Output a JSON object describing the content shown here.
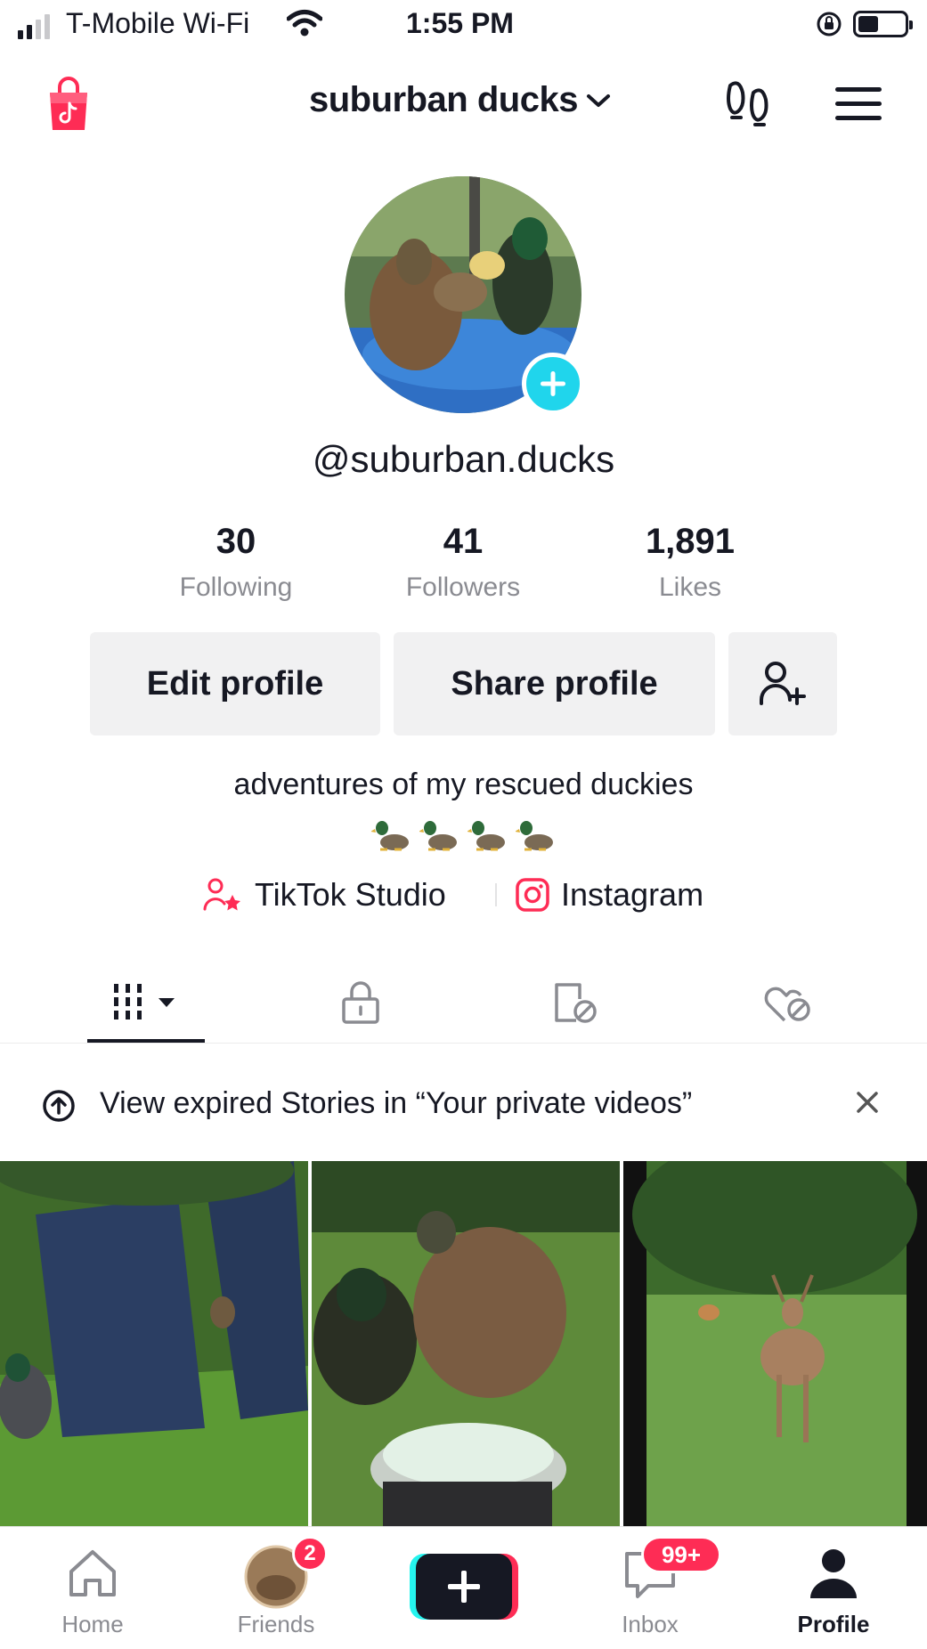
{
  "status_bar": {
    "carrier": "T-Mobile Wi-Fi",
    "time": "1:55 PM"
  },
  "header": {
    "account_name": "suburban ducks"
  },
  "profile": {
    "username": "@suburban.ducks",
    "stats": [
      {
        "value": "30",
        "label": "Following"
      },
      {
        "value": "41",
        "label": "Followers"
      },
      {
        "value": "1,891",
        "label": "Likes"
      }
    ],
    "edit_label": "Edit profile",
    "share_label": "Share profile",
    "bio": "adventures of my rescued duckies",
    "links": [
      {
        "label": "TikTok Studio",
        "icon": "creator-person-icon"
      },
      {
        "label": "Instagram",
        "icon": "instagram-icon"
      }
    ]
  },
  "tabs": [
    {
      "name": "videos-grid",
      "icon": "grid-icon",
      "active": true
    },
    {
      "name": "private",
      "icon": "lock-icon",
      "active": false
    },
    {
      "name": "reposts",
      "icon": "repost-icon",
      "active": false
    },
    {
      "name": "liked",
      "icon": "liked-heart-icon",
      "active": false
    }
  ],
  "notice": {
    "text": "View expired Stories in “Your private videos”"
  },
  "videos": [
    {
      "scene": "ducks-by-trash-bin"
    },
    {
      "scene": "ducks-eating-from-bowl"
    },
    {
      "scene": "deer-in-yard"
    }
  ],
  "tabbar": {
    "home": "Home",
    "friends": "Friends",
    "friends_badge": "2",
    "inbox": "Inbox",
    "inbox_badge": "99+",
    "profile": "Profile"
  },
  "colors": {
    "accent_pink": "#fe2c55",
    "accent_cyan": "#20d5ec",
    "text": "#161823",
    "muted": "#8a8b91",
    "button_bg": "#f1f1f2"
  }
}
